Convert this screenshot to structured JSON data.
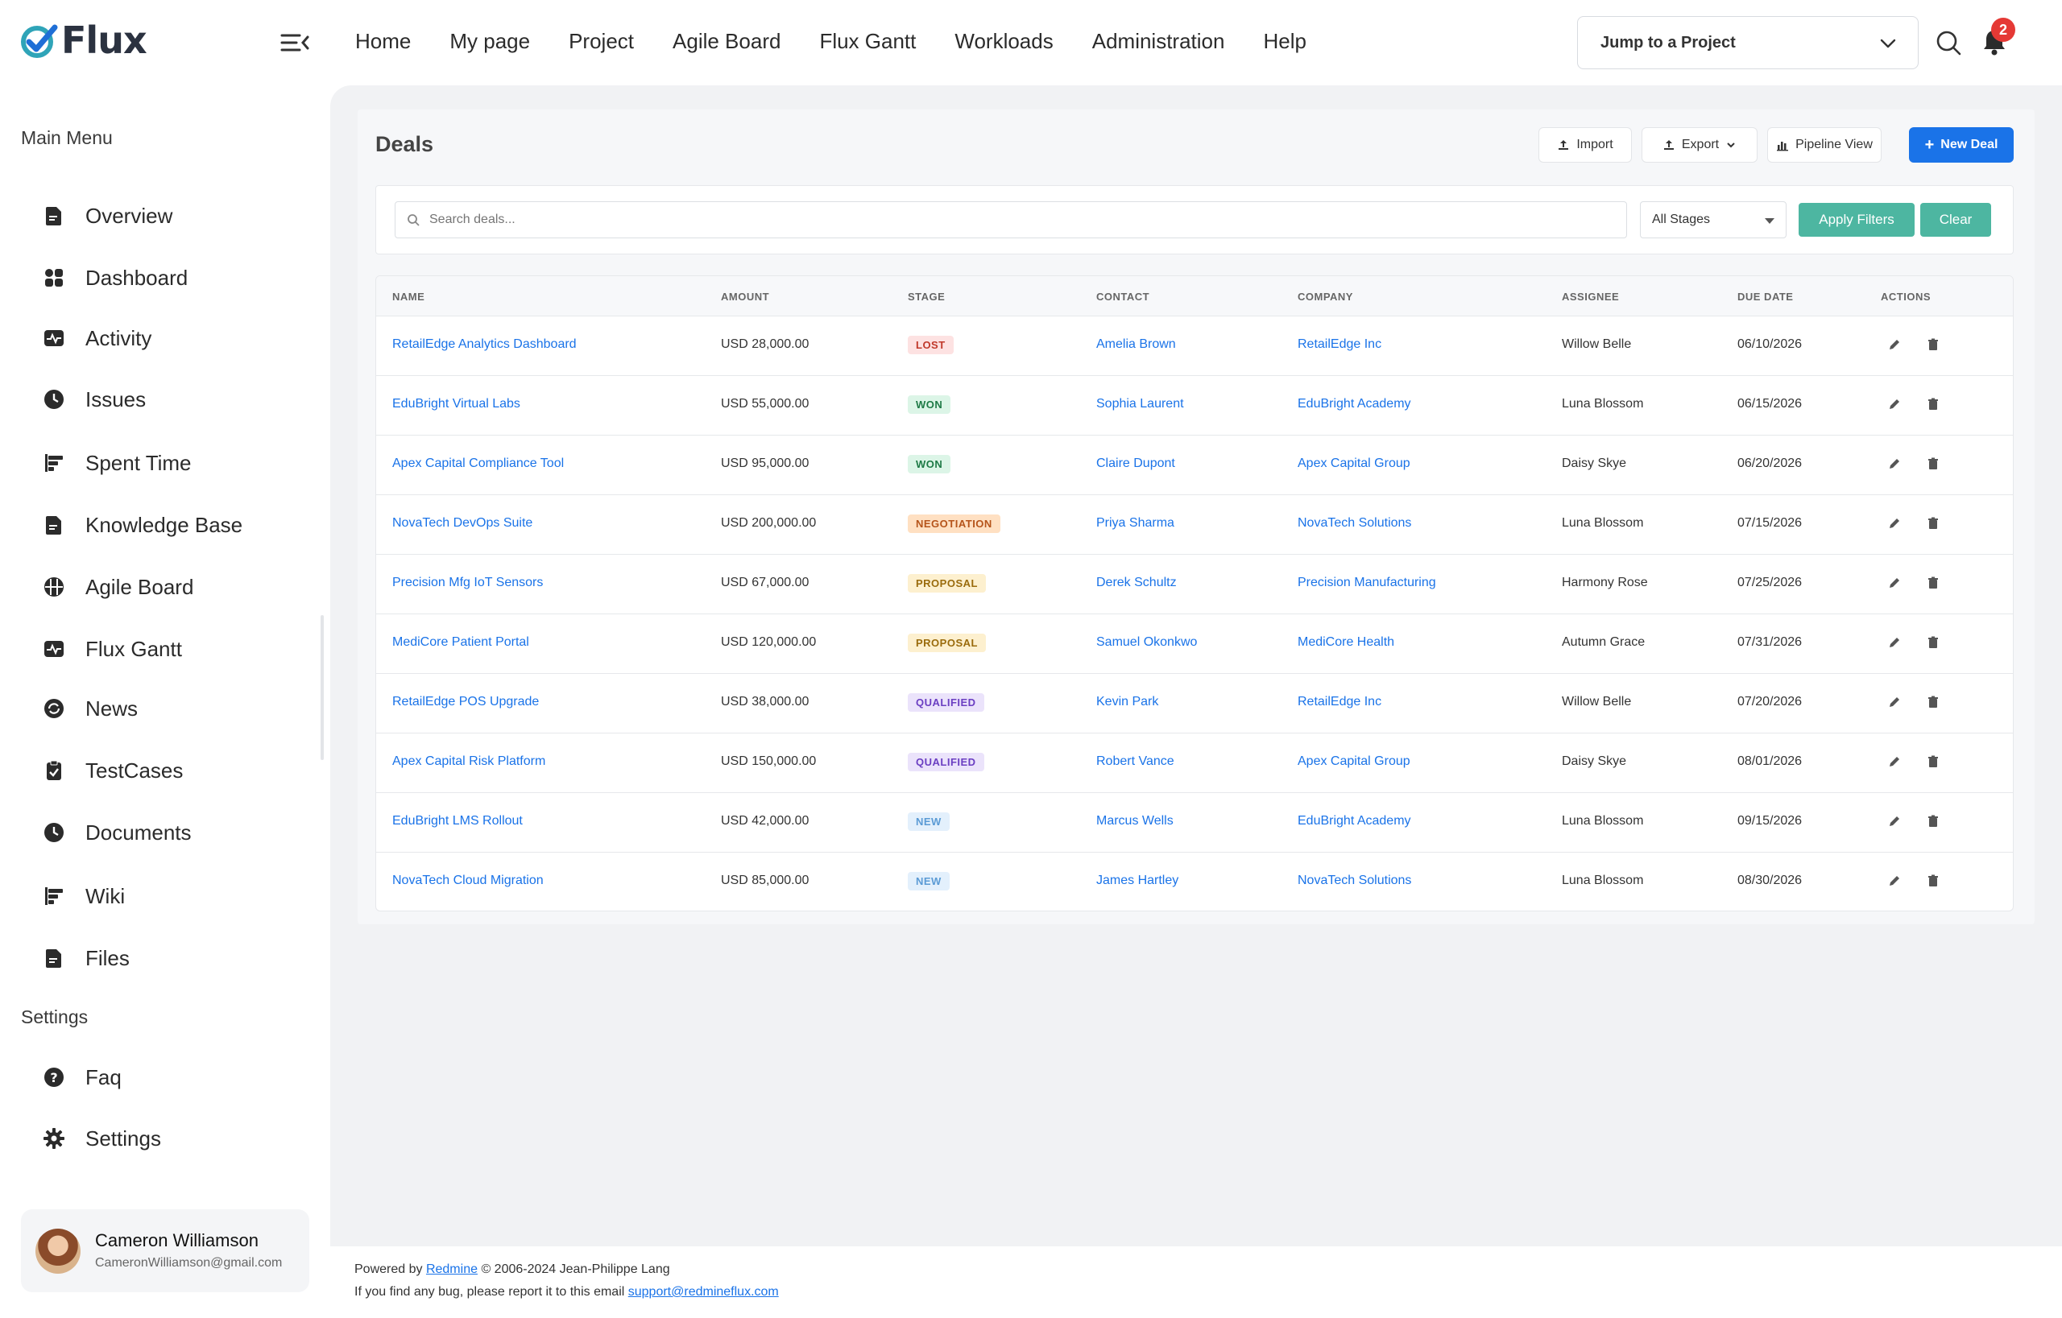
{
  "app": {
    "name": "Flux"
  },
  "topnav": [
    "Home",
    "My page",
    "Project",
    "Agile Board",
    "Flux Gantt",
    "Workloads",
    "Administration",
    "Help"
  ],
  "jump_project": {
    "label": "Jump to a Project"
  },
  "notifications": {
    "count": "2"
  },
  "sidebar": {
    "main_title": "Main Menu",
    "items": [
      {
        "label": "Overview",
        "icon": "document-icon"
      },
      {
        "label": "Dashboard",
        "icon": "grid-icon"
      },
      {
        "label": "Activity",
        "icon": "pulse-icon"
      },
      {
        "label": "Issues",
        "icon": "clock-icon"
      },
      {
        "label": "Spent Time",
        "icon": "bars-icon"
      },
      {
        "label": "Knowledge Base",
        "icon": "document-icon"
      },
      {
        "label": "Agile Board",
        "icon": "board-icon"
      },
      {
        "label": "Flux Gantt",
        "icon": "pulse-icon"
      },
      {
        "label": "News",
        "icon": "refresh-icon"
      },
      {
        "label": "TestCases",
        "icon": "clipboard-icon"
      },
      {
        "label": "Documents",
        "icon": "clock-icon"
      },
      {
        "label": "Wiki",
        "icon": "bars-icon"
      },
      {
        "label": "Files",
        "icon": "document-icon"
      }
    ],
    "settings_title": "Settings",
    "settings_items": [
      {
        "label": "Faq",
        "icon": "question-icon"
      },
      {
        "label": "Settings",
        "icon": "gear-icon"
      }
    ],
    "user": {
      "name": "Cameron Williamson",
      "email": "CameronWilliamson@gmail.com"
    }
  },
  "deals": {
    "title": "Deals",
    "buttons": {
      "import": "Import",
      "export": "Export",
      "pipeline": "Pipeline View",
      "new": "New Deal"
    },
    "filters": {
      "search_placeholder": "Search deals...",
      "stage": "All Stages",
      "apply": "Apply Filters",
      "clear": "Clear"
    },
    "columns": [
      "NAME",
      "AMOUNT",
      "STAGE",
      "CONTACT",
      "COMPANY",
      "ASSIGNEE",
      "DUE DATE",
      "ACTIONS"
    ],
    "rows": [
      {
        "name": "RetailEdge Analytics Dashboard",
        "amount": "USD 28,000.00",
        "stage": "LOST",
        "contact": "Amelia Brown",
        "company": "RetailEdge Inc",
        "assignee": "Willow Belle",
        "due": "06/10/2026"
      },
      {
        "name": "EduBright Virtual Labs",
        "amount": "USD 55,000.00",
        "stage": "WON",
        "contact": "Sophia Laurent",
        "company": "EduBright Academy",
        "assignee": "Luna Blossom",
        "due": "06/15/2026"
      },
      {
        "name": "Apex Capital Compliance Tool",
        "amount": "USD 95,000.00",
        "stage": "WON",
        "contact": "Claire Dupont",
        "company": "Apex Capital Group",
        "assignee": "Daisy Skye",
        "due": "06/20/2026"
      },
      {
        "name": "NovaTech DevOps Suite",
        "amount": "USD 200,000.00",
        "stage": "NEGOTIATION",
        "contact": "Priya Sharma",
        "company": "NovaTech Solutions",
        "assignee": "Luna Blossom",
        "due": "07/15/2026"
      },
      {
        "name": "Precision Mfg IoT Sensors",
        "amount": "USD 67,000.00",
        "stage": "PROPOSAL",
        "contact": "Derek Schultz",
        "company": "Precision Manufacturing",
        "assignee": "Harmony Rose",
        "due": "07/25/2026"
      },
      {
        "name": "MediCore Patient Portal",
        "amount": "USD 120,000.00",
        "stage": "PROPOSAL",
        "contact": "Samuel Okonkwo",
        "company": "MediCore Health",
        "assignee": "Autumn Grace",
        "due": "07/31/2026"
      },
      {
        "name": "RetailEdge POS Upgrade",
        "amount": "USD 38,000.00",
        "stage": "QUALIFIED",
        "contact": "Kevin Park",
        "company": "RetailEdge Inc",
        "assignee": "Willow Belle",
        "due": "07/20/2026"
      },
      {
        "name": "Apex Capital Risk Platform",
        "amount": "USD 150,000.00",
        "stage": "QUALIFIED",
        "contact": "Robert Vance",
        "company": "Apex Capital Group",
        "assignee": "Daisy Skye",
        "due": "08/01/2026"
      },
      {
        "name": "EduBright LMS Rollout",
        "amount": "USD 42,000.00",
        "stage": "NEW",
        "contact": "Marcus Wells",
        "company": "EduBright Academy",
        "assignee": "Luna Blossom",
        "due": "09/15/2026"
      },
      {
        "name": "NovaTech Cloud Migration",
        "amount": "USD 85,000.00",
        "stage": "NEW",
        "contact": "James Hartley",
        "company": "NovaTech Solutions",
        "assignee": "Luna Blossom",
        "due": "08/30/2026"
      }
    ],
    "stage_colors": {
      "LOST": {
        "bg": "#fde2e2",
        "fg": "#c0392b"
      },
      "WON": {
        "bg": "#dcf5e7",
        "fg": "#1e7a46"
      },
      "NEGOTIATION": {
        "bg": "#ffe0c2",
        "fg": "#b5541a"
      },
      "PROPOSAL": {
        "bg": "#fdf0cf",
        "fg": "#9a6b0c"
      },
      "QUALIFIED": {
        "bg": "#ebe3fb",
        "fg": "#6b3fc2"
      },
      "NEW": {
        "bg": "#e3f0fc",
        "fg": "#5b9bd5"
      }
    }
  },
  "footer": {
    "powered_prefix": "Powered by",
    "powered_link": "Redmine",
    "powered_suffix": "© 2006-2024 Jean-Philippe Lang",
    "bug_text": "If you find any bug, please report it to this email",
    "bug_email": "support@redmineflux.com"
  }
}
